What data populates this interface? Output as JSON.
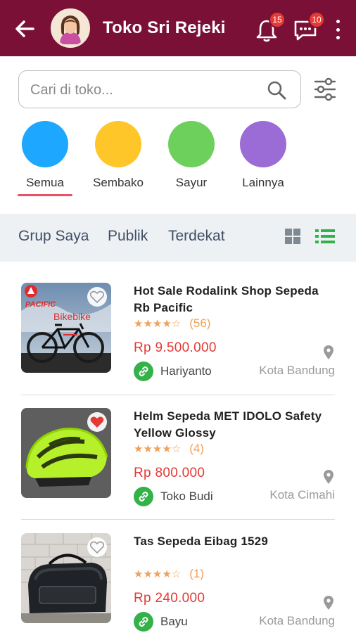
{
  "header": {
    "title": "Toko Sri Rejeki",
    "notifications_count": "15",
    "messages_count": "10"
  },
  "search": {
    "placeholder": "Cari di toko..."
  },
  "categories": [
    {
      "label": "Semua",
      "color": "#1ea7ff",
      "active": true
    },
    {
      "label": "Sembako",
      "color": "#ffc629"
    },
    {
      "label": "Sayur",
      "color": "#6dd05c"
    },
    {
      "label": "Lainnya",
      "color": "#9b6bd6"
    }
  ],
  "filter_tabs": [
    "Grup Saya",
    "Publik",
    "Terdekat"
  ],
  "view_mode": {
    "grid_icon": "grid-icon",
    "list_icon": "list-icon",
    "active": "list"
  },
  "products": [
    {
      "name": "Hot Sale Rodalink Shop Sepeda Rb Pacific",
      "stars": "★★★★☆",
      "reviews": "(56)",
      "price": "Rp 9.500.000",
      "seller": "Hariyanto",
      "location": "Kota Bandung",
      "favorited": false,
      "image_text": "Bikebike"
    },
    {
      "name": "Helm Sepeda MET IDOLO Safety Yellow Glossy",
      "stars": "★★★★☆",
      "reviews": "(4)",
      "price": "Rp 800.000",
      "seller": "Toko Budi",
      "location": "Kota Cimahi",
      "favorited": true
    },
    {
      "name": "Tas Sepeda Eibag 1529",
      "stars": "★★★★☆",
      "reviews": "(1)",
      "price": "Rp 240.000",
      "seller": "Bayu",
      "location": "Kota Bandung",
      "favorited": false
    }
  ],
  "colors": {
    "appbar": "#7a1035",
    "price": "#e53935",
    "accent_green": "#34b24a",
    "rating": "#f0a15b"
  }
}
